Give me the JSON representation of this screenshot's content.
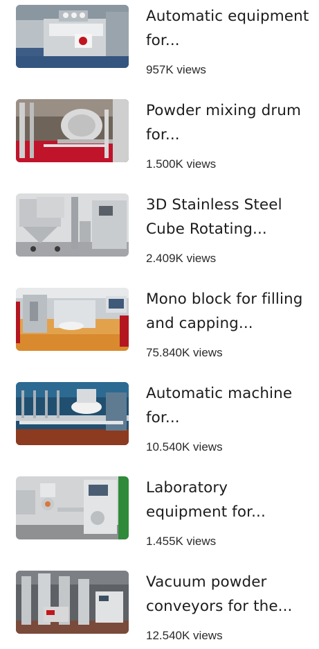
{
  "videos": [
    {
      "title": "Automatic equipment for...",
      "views": "957K views",
      "thumbnail_icon": "tablet-press-machine-thumbnail",
      "palette": {
        "bg": "#5a6b7a",
        "floor": "#3f5f8a",
        "metal": "#cfd3d6",
        "accent": "#e8e8e8"
      }
    },
    {
      "title": "Powder mixing drum for...",
      "views": "1.500K views",
      "thumbnail_icon": "mixing-drum-thumbnail",
      "palette": {
        "bg": "#6e6258",
        "floor": "#c0142b",
        "metal": "#d7d7d7",
        "accent": "#b9b9b9"
      }
    },
    {
      "title": "3D Stainless Steel Cube Rotating...",
      "views": "2.409K views",
      "thumbnail_icon": "cube-mixer-thumbnail",
      "palette": {
        "bg": "#d9dadb",
        "floor": "#9a9c9e",
        "metal": "#bfc2c5",
        "accent": "#7d8185"
      }
    },
    {
      "title": "Mono block for filling and capping...",
      "views": "75.840K views",
      "thumbnail_icon": "filling-capping-machine-thumbnail",
      "palette": {
        "bg": "#c8cdd2",
        "floor": "#d9892f",
        "metal": "#e1e3e5",
        "accent": "#b4161f"
      }
    },
    {
      "title": "Automatic machine for...",
      "views": "10.540K views",
      "thumbnail_icon": "bottling-line-thumbnail",
      "palette": {
        "bg": "#1f4e6e",
        "floor": "#9a3a1e",
        "metal": "#c9ced3",
        "accent": "#f0f0f0"
      }
    },
    {
      "title": "Laboratory equipment for...",
      "views": "1.455K views",
      "thumbnail_icon": "lab-equipment-thumbnail",
      "palette": {
        "bg": "#cfd1d3",
        "floor": "#8c8e90",
        "metal": "#e4e5e6",
        "accent": "#2f8a3a"
      }
    },
    {
      "title": "Vacuum powder conveyors for the...",
      "views": "12.540K views",
      "thumbnail_icon": "vacuum-conveyor-thumbnail",
      "palette": {
        "bg": "#5d6064",
        "floor": "#7a4a3a",
        "metal": "#c3c6c9",
        "accent": "#d8d8d8"
      }
    }
  ]
}
